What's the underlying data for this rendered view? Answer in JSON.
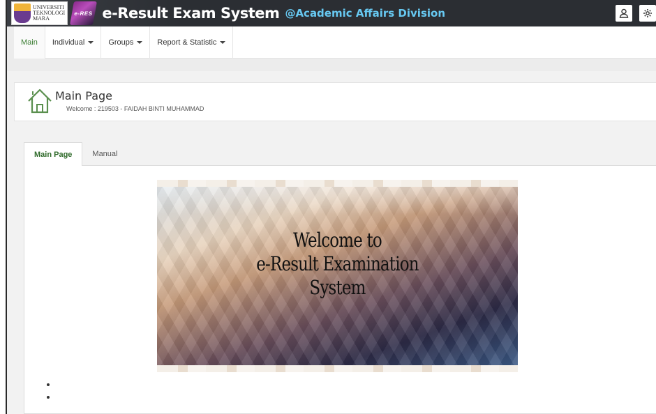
{
  "header": {
    "logo_university": [
      "UNIVERSITI",
      "TEKNOLOGI",
      "MARA"
    ],
    "logo_badge": "e-RES",
    "title": "e-Result Exam System",
    "subtitle": "@Academic Affairs Division",
    "icons": [
      "user-icon",
      "gear-icon"
    ]
  },
  "nav": {
    "items": [
      {
        "label": "Main",
        "active": true
      },
      {
        "label": "Individual",
        "dropdown": true
      },
      {
        "label": "Groups",
        "dropdown": true
      },
      {
        "label": "Report & Statistic",
        "dropdown": true
      }
    ]
  },
  "page": {
    "title": "Main Page",
    "welcome": "Welcome : 219503 - FAIDAH BINTI MUHAMMAD",
    "icon": "home-icon"
  },
  "tabs": [
    {
      "label": "Main Page",
      "active": true
    },
    {
      "label": "Manual",
      "active": false
    }
  ],
  "banner": {
    "line1": "Welcome to",
    "line2": "e-Result Examination",
    "line3": "System"
  },
  "colors": {
    "header_bg": "#2b2e33",
    "subtitle": "#67c9f2",
    "active_green": "#3a7d32"
  }
}
